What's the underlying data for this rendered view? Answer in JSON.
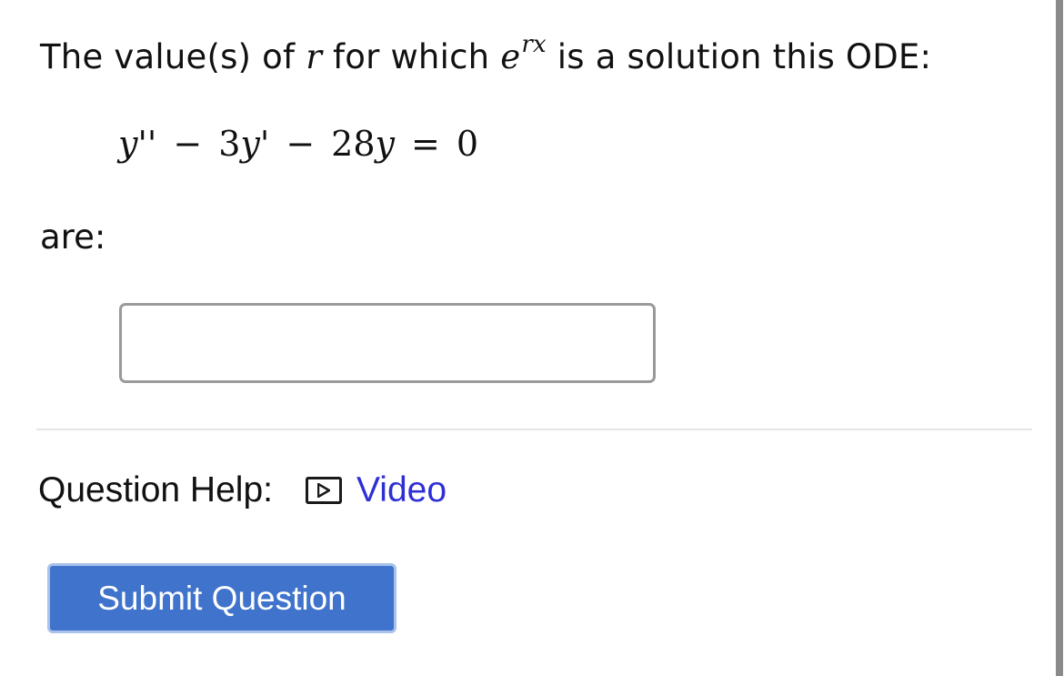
{
  "question": {
    "prompt_before": "The value(s) of ",
    "var_r": "r",
    "prompt_middle": " for which ",
    "exp_base": "e",
    "exp_power": "rx",
    "prompt_after": " is a solution this ODE:",
    "equation": {
      "term1": "y''",
      "op1": "−",
      "term2_coef": "3",
      "term2_var": "y'",
      "op2": "−",
      "term3_coef": "28",
      "term3_var": "y",
      "equals": "=",
      "rhs": "0"
    },
    "are_label": "are:"
  },
  "answer": {
    "value": "",
    "placeholder": ""
  },
  "help": {
    "label": "Question Help:",
    "video_icon": "play-video-icon",
    "video_label": "Video"
  },
  "submit": {
    "label": "Submit Question"
  },
  "colors": {
    "link": "#2f2fd6",
    "button_bg": "#3f73cc",
    "button_border": "#a9c2ea",
    "input_border": "#9a9a9a"
  }
}
